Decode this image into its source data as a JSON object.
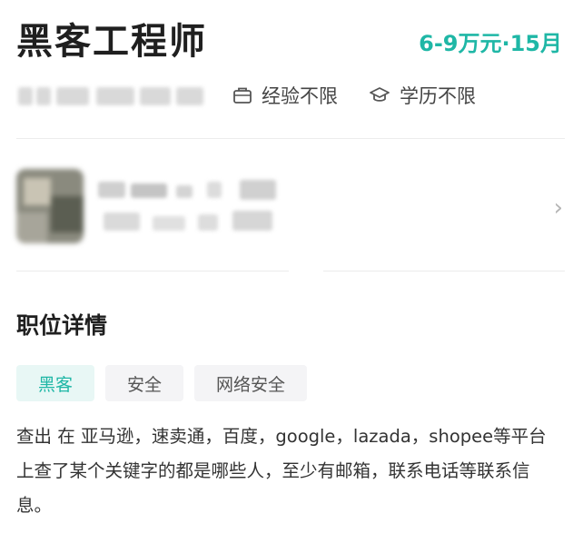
{
  "job": {
    "title": "黑客工程师",
    "salary": "6-9万元·15月",
    "experience": "经验不限",
    "education": "学历不限"
  },
  "details": {
    "section_title": "职位详情",
    "tags": [
      "黑客",
      "安全",
      "网络安全"
    ],
    "description": "查出 在 亚马逊，速卖通，百度，google，lazada，shopee等平台上查了某个关键字的都是哪些人，至少有邮箱，联系电话等联系信息。"
  },
  "icons": {
    "experience": "briefcase-icon",
    "education": "graduation-cap-icon",
    "company_link": "chevron-right-icon"
  },
  "colors": {
    "accent": "#1fb7a6",
    "active_tag_bg": "#e8f7f5",
    "tag_bg": "#f4f4f6"
  }
}
